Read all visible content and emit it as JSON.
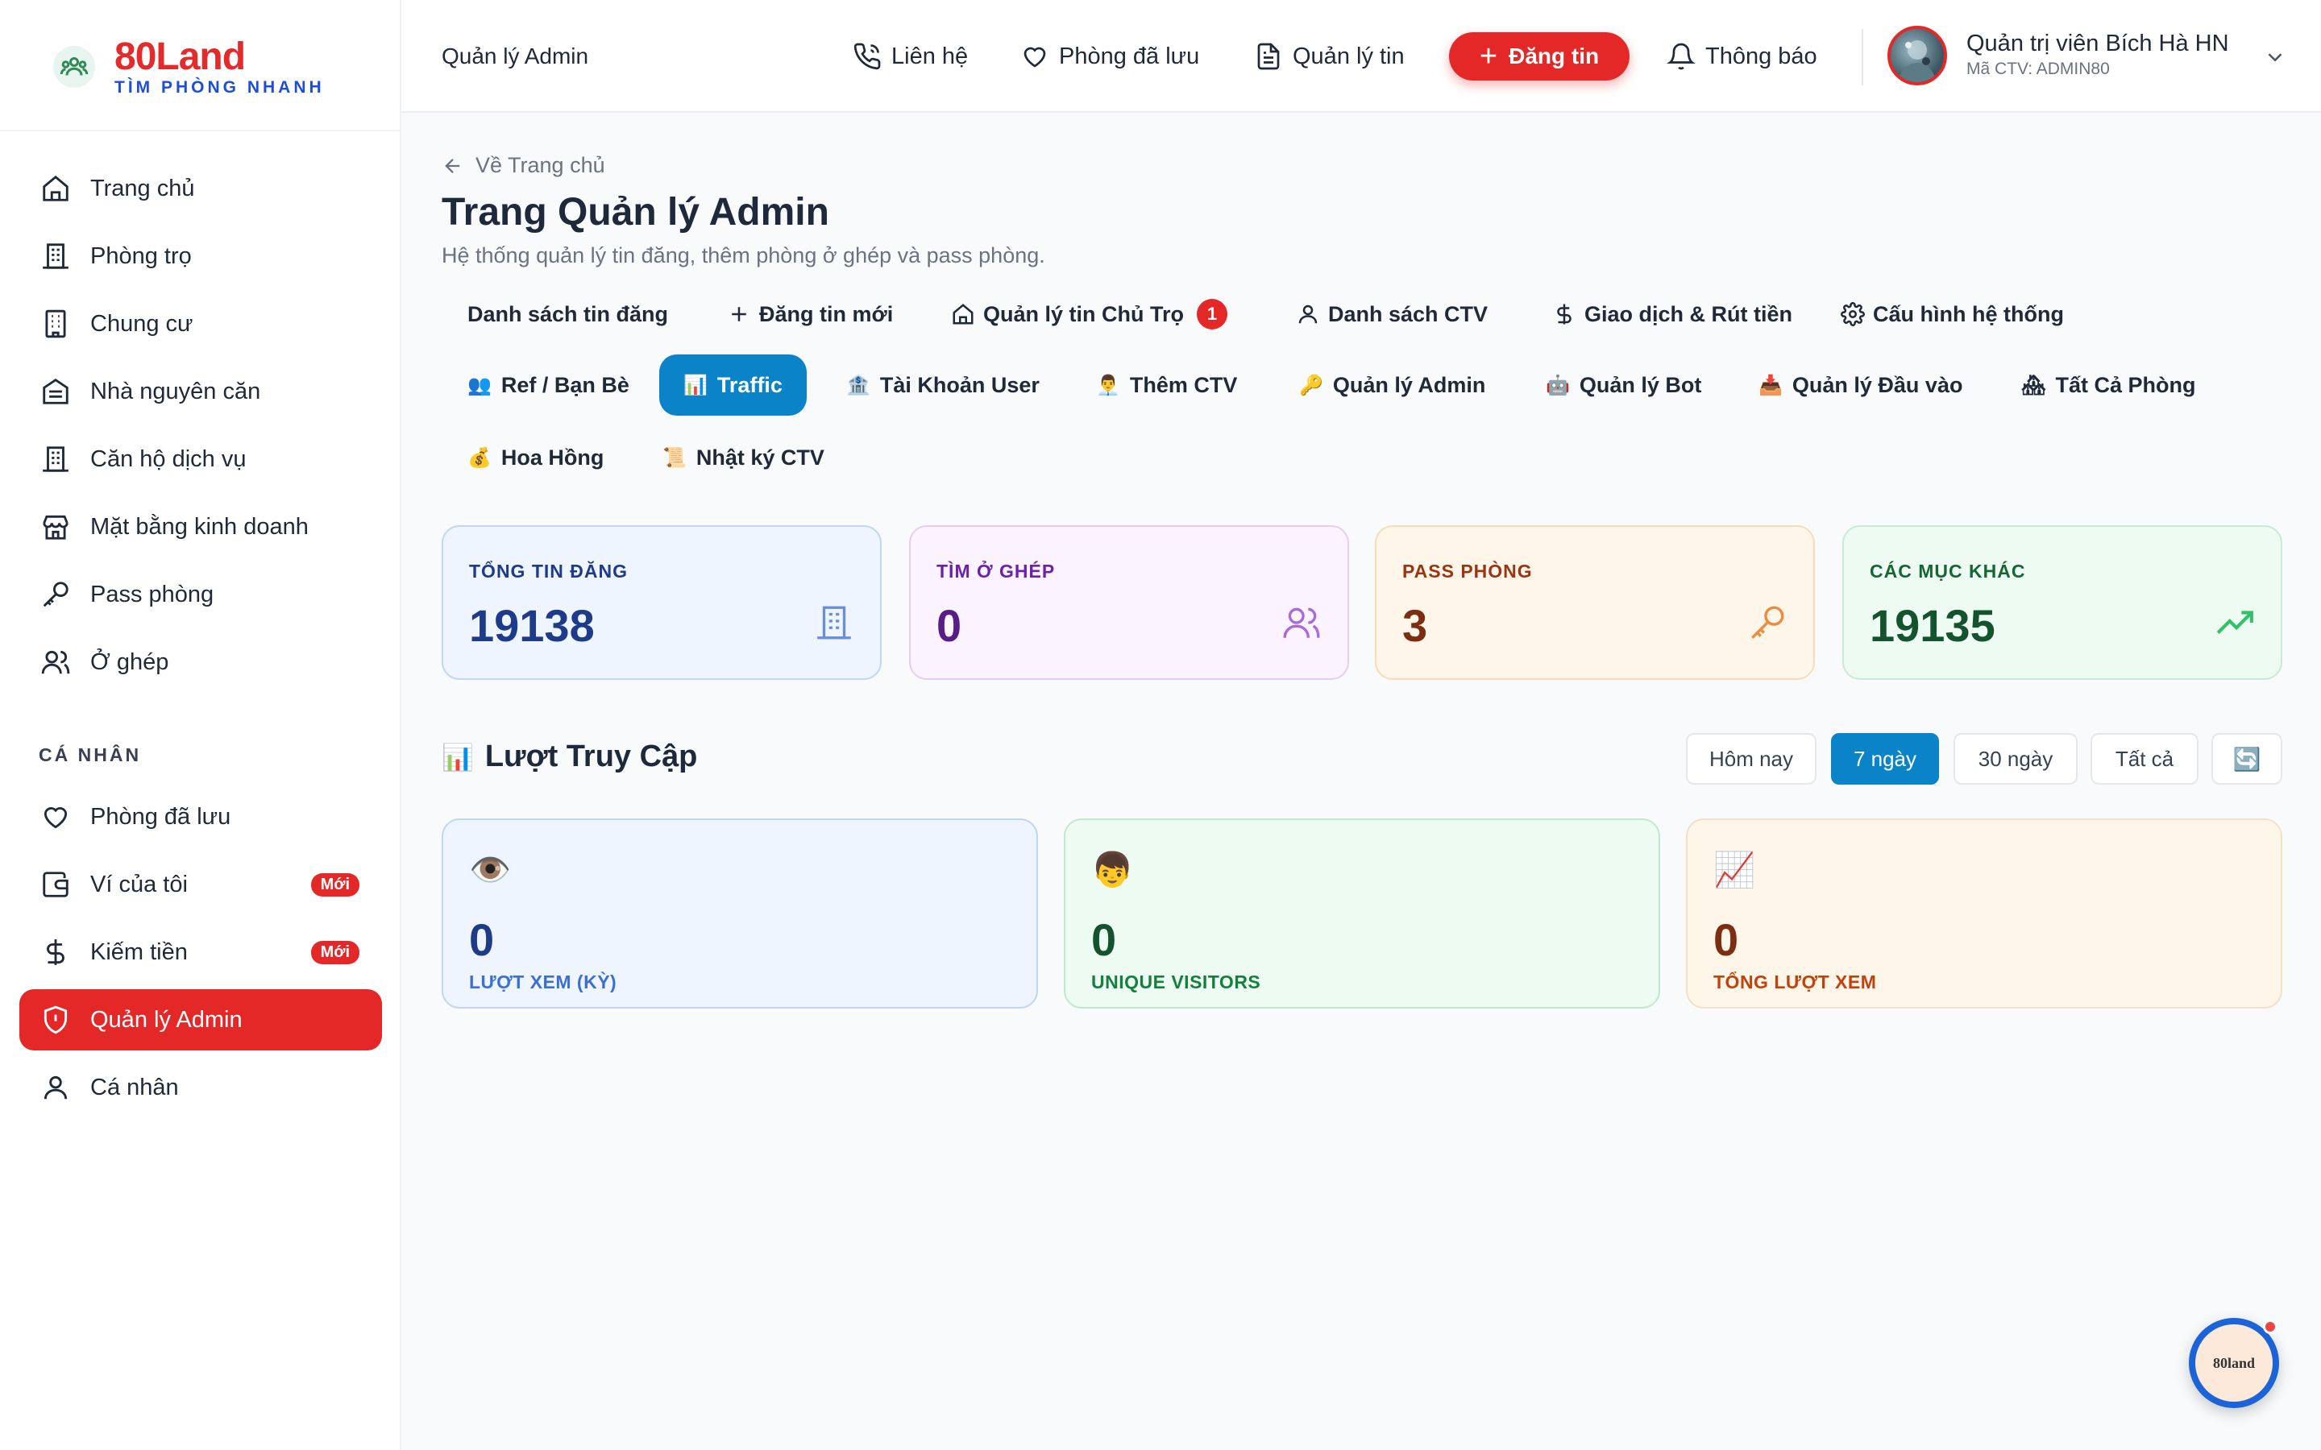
{
  "brand": {
    "name": "80Land",
    "tagline": "TÌM PHÒNG NHANH"
  },
  "sidebar": {
    "main_items": [
      {
        "label": "Trang chủ",
        "icon": "home-icon"
      },
      {
        "label": "Phòng trọ",
        "icon": "building-icon"
      },
      {
        "label": "Chung cư",
        "icon": "apartment-icon"
      },
      {
        "label": "Nhà nguyên căn",
        "icon": "house-icon"
      },
      {
        "label": "Căn hộ dịch vụ",
        "icon": "building-icon"
      },
      {
        "label": "Mặt bằng kinh doanh",
        "icon": "store-icon"
      },
      {
        "label": "Pass phòng",
        "icon": "key-icon"
      },
      {
        "label": "Ở ghép",
        "icon": "users-icon"
      }
    ],
    "section_label": "CÁ NHÂN",
    "personal_items": [
      {
        "label": "Phòng đã lưu",
        "icon": "heart-icon"
      },
      {
        "label": "Ví của tôi",
        "icon": "wallet-icon",
        "badge": "Mới"
      },
      {
        "label": "Kiếm tiền",
        "icon": "dollar-icon",
        "badge": "Mới"
      },
      {
        "label": "Quản lý Admin",
        "icon": "shield-icon",
        "active": true
      },
      {
        "label": "Cá nhân",
        "icon": "user-icon"
      }
    ]
  },
  "header": {
    "title": "Quản lý Admin",
    "links": {
      "contact": "Liên hệ",
      "saved": "Phòng đã lưu",
      "manage": "Quản lý tin",
      "post": "Đăng tin",
      "notify": "Thông báo"
    },
    "user": {
      "name": "Quản trị viên Bích Hà HN",
      "code": "Mã CTV: ADMIN80"
    }
  },
  "page": {
    "back": "Về Trang chủ",
    "title": "Trang Quản lý Admin",
    "subtitle": "Hệ thống quản lý tin đăng, thêm phòng ở ghép và pass phòng."
  },
  "tabs": [
    {
      "label": "Danh sách tin đăng"
    },
    {
      "label": "Đăng tin mới"
    },
    {
      "label": "Quản lý tin Chủ Trọ",
      "badge": "1"
    },
    {
      "label": "Danh sách CTV"
    },
    {
      "label": "Giao dịch & Rút tiền"
    },
    {
      "label": "Cấu hình hệ thống"
    },
    {
      "label": "Ref / Bạn Bè",
      "emoji": "👥"
    },
    {
      "label": "Traffic",
      "emoji": "📊",
      "active": true
    },
    {
      "label": "Tài Khoản User",
      "emoji": "🏦"
    },
    {
      "label": "Thêm CTV",
      "emoji": "👨‍💼"
    },
    {
      "label": "Quản lý Admin",
      "emoji": "🔑"
    },
    {
      "label": "Quản lý Bot",
      "emoji": "🤖"
    },
    {
      "label": "Quản lý Đầu vào",
      "emoji": "📥"
    },
    {
      "label": "Tất Cả Phòng",
      "emoji": "🏘"
    },
    {
      "label": "Hoa Hồng",
      "emoji": "💰"
    },
    {
      "label": "Nhật ký CTV",
      "emoji": "📜"
    }
  ],
  "stats": [
    {
      "label": "TỔNG TIN ĐĂNG",
      "value": "19138",
      "color": "#1e3a8a",
      "icon": "building-icon"
    },
    {
      "label": "TÌM Ở GHÉP",
      "value": "0",
      "color": "#581c87",
      "icon": "users-icon"
    },
    {
      "label": "PASS PHÒNG",
      "value": "3",
      "color": "#7c2d12",
      "icon": "key-icon"
    },
    {
      "label": "CÁC MỤC KHÁC",
      "value": "19135",
      "color": "#14532d",
      "icon": "trending-up-icon"
    }
  ],
  "traffic": {
    "title": "Lượt Truy Cập",
    "title_emoji": "📊",
    "ranges": [
      "Hôm nay",
      "7 ngày",
      "30 ngày",
      "Tất cả"
    ],
    "active_range": "7 ngày",
    "refresh_icon": "🔄",
    "cards": [
      {
        "emoji": "👁️",
        "value": "0",
        "label": "LƯỢT XEM (KỲ)"
      },
      {
        "emoji": "👦",
        "value": "0",
        "label": "UNIQUE VISITORS"
      },
      {
        "emoji": "📈",
        "value": "0",
        "label": "TỔNG LƯỢT XEM"
      }
    ]
  },
  "fab": {
    "label": "80land"
  }
}
